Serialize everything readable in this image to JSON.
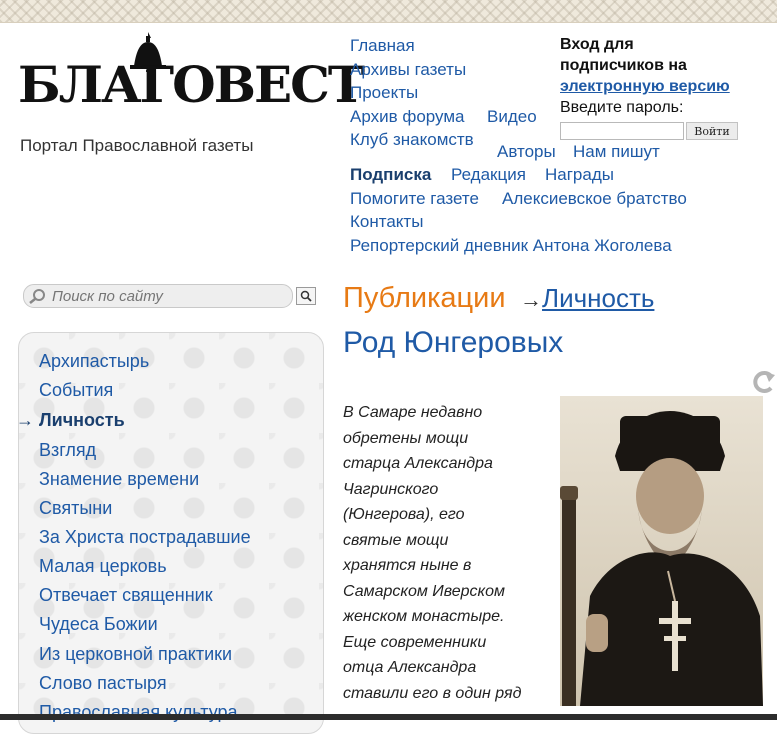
{
  "logo": {
    "wordmark": "БЛАГОВЕСТ",
    "tagline": "Портал Православной газеты"
  },
  "nav": {
    "items": [
      "Главная",
      "Архивы газеты",
      "Проекты",
      "Архив форума",
      "Видео",
      "Клуб знакомств",
      "Авторы",
      "Нам пишут"
    ],
    "row2": [
      "Подписка",
      "Редакция",
      "Награды",
      "Помогите газете",
      "Алексиевское братство",
      "Контакты",
      "Репортерский дневник Антона Жоголева"
    ]
  },
  "login": {
    "title_line1": "Вход для",
    "title_line2": "подписчиков на",
    "title_link": "электронную версию",
    "password_label": "Введите пароль:",
    "password_value": "",
    "submit_label": "Войти"
  },
  "search": {
    "placeholder": "Поиск по сайту"
  },
  "sidebar": {
    "items": [
      "Архипастырь",
      "События",
      "Личность",
      "Взгляд",
      "Знамение времени",
      "Святыни",
      "За Христа пострадавшие",
      "Малая церковь",
      "Отвечает священник",
      "Чудеса Божии",
      "Из церковной практики",
      "Слово пастыря",
      "Православная культура"
    ],
    "active_index": 2,
    "active_arrow": "→"
  },
  "breadcrumb": {
    "section": "Публикации",
    "arrow": "→",
    "subsection": "Личность"
  },
  "article": {
    "title": "Род Юнгеровых",
    "lines": [
      "В Самаре недавно",
      "обретены мощи",
      "старца Александра",
      "Чагринского",
      "(Юнгерова), его",
      "святые мощи",
      "хранятся ныне в",
      "Самарском Иверском",
      "женском монастыре.",
      "Еще современники",
      "отца Александра",
      "ставили его в один ряд"
    ]
  },
  "colors": {
    "link": "#1f5aa6",
    "accent": "#e77a14"
  }
}
